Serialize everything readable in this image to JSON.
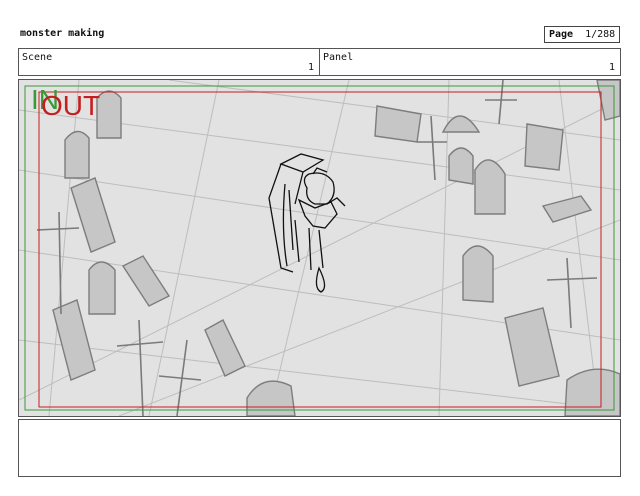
{
  "header": {
    "project_title": "monster making",
    "page_label": "Page",
    "page_value": "1/288"
  },
  "fields": {
    "scene_label": "Scene",
    "scene_value": "1",
    "panel_label": "Panel",
    "panel_value": "1"
  },
  "frame": {
    "in_label": "IN",
    "out_label": "OUT",
    "in_color": "#3a9a3a",
    "out_color": "#c61e1e"
  },
  "notes": {
    "text": ""
  }
}
